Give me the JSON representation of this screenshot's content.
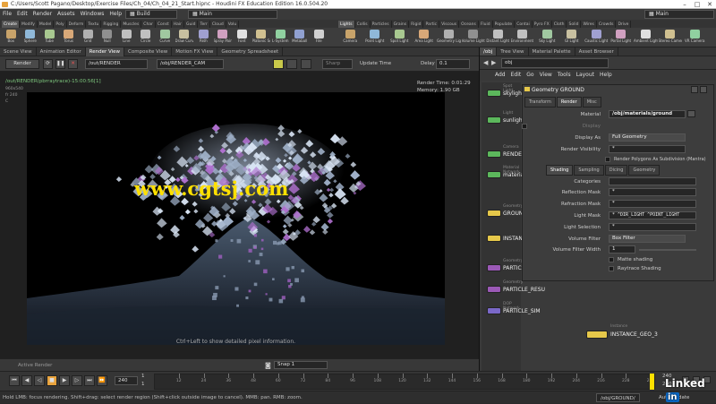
{
  "window": {
    "title": "C:/Users/Scott Pagano/Desktop/Exercise Files/Ch_04/Ch_04_21_Start.hipnc - Houdini FX Education Edition 16.0.504.20"
  },
  "menu": {
    "items": [
      "File",
      "Edit",
      "Render",
      "Assets",
      "Windows",
      "Help"
    ],
    "desktop_left": "Build",
    "desktop_center": "Main",
    "desktop_right": "Main"
  },
  "shelf": {
    "left_tabs": [
      "Create",
      "Modify",
      "Model",
      "Poly",
      "Deform",
      "Textu",
      "Rigging",
      "Muscles",
      "Char",
      "Const",
      "Hair",
      "Guid",
      "Terr",
      "Cloud",
      "Volu"
    ],
    "right_tabs": [
      "Lights",
      "Collis",
      "Particles",
      "Grains",
      "Rigid",
      "Partic",
      "Viscous",
      "Oceans",
      "Fluid",
      "Populate",
      "Contai",
      "Pyro FX",
      "Cloth",
      "Solid",
      "Wires",
      "Crowds",
      "Drive"
    ],
    "left_tools": [
      "Box",
      "Sphere",
      "Tube",
      "Torus",
      "Grid",
      "Null",
      "Line",
      "Circle",
      "Curve",
      "Draw Curve",
      "Path",
      "Spray Paint",
      "Font",
      "Platonic Solids",
      "L-System",
      "Metaball",
      "File"
    ],
    "right_tools": [
      "Camera",
      "Point Light",
      "Spot Light",
      "Area Light",
      "Geometry Light",
      "Volume Light",
      "Distant Light",
      "Environment Light",
      "Sky Light",
      "GI Light",
      "Caustic Light",
      "Portal Light",
      "Ambient Light",
      "Stereo Camera",
      "VR Camera"
    ]
  },
  "left_pane": {
    "tabs": [
      "Scene View",
      "Animation Editor",
      "Render View",
      "Composite View",
      "Motion FX View",
      "Geometry Spreadsheet"
    ],
    "toolbar": {
      "render_button": "Render",
      "out_path": "/out/RENDER",
      "cam_path": "/obj/RENDER_CAM",
      "sharp": "Sharp",
      "update_time": "Update Time",
      "delay_label": "Delay",
      "delay_value": "0.1"
    },
    "render_info": {
      "title": "/out/RENDER(pbrraytrace)-15:00:56[1]",
      "size": "960x540",
      "fr": "fr 240",
      "channel": "C",
      "render_time": "Render Time: 0:01:29",
      "memory": "Memory:      1.90 GB"
    },
    "watermark": "www.cgtsj.com",
    "hint": "Ctrl+Left to show detailed pixel information.",
    "bottom": {
      "active_render": "Active Render",
      "snap": "Snap 1"
    }
  },
  "right_pane": {
    "tabs": [
      "/obj",
      "Tree View",
      "Material Palette",
      "Asset Browser"
    ],
    "path": "obj",
    "menu": [
      "Add",
      "Edit",
      "Go",
      "View",
      "Tools",
      "Layout",
      "Help"
    ],
    "nodes": [
      {
        "type": "Spot Light",
        "name": "skylight1",
        "color": "#5cb85c"
      },
      {
        "type": "Light",
        "name": "sunlight1",
        "color": "#5cb85c"
      },
      {
        "type": "Camera",
        "name": "RENDER_CAM",
        "color": "#5cb85c"
      },
      {
        "type": "Material Network",
        "name": "materials",
        "color": "#5cb85c"
      },
      {
        "type": "Geometry",
        "name": "GROUND",
        "color": "#e6c84a"
      },
      {
        "type": "",
        "name": "INSTANCES",
        "color": "#e6c84a"
      },
      {
        "type": "Geometry",
        "name": "PARTICLE_SOU",
        "color": "#9b59b6"
      },
      {
        "type": "Geometry",
        "name": "PARTICLE_RESU",
        "color": "#9b59b6"
      },
      {
        "type": "DOP Network",
        "name": "PARTICLE_SIM",
        "color": "#7a68c8"
      }
    ],
    "instance_node": {
      "type": "Instance",
      "name": "INSTANCE_GEO_3"
    },
    "parms": {
      "header_type": "Geometry",
      "header_name": "GROUND",
      "tabs": [
        "Transform",
        "Render",
        "Misc"
      ],
      "material_label": "Material",
      "material_value": "/obj/materials/ground",
      "display_label": "Display",
      "display_as_label": "Display As",
      "display_as_value": "Full Geometry",
      "render_visibility_label": "Render Visibility",
      "render_visibility_value": "*",
      "subdiv_label": "Render Polygons As Subdivision (Mantra)",
      "subtabs": [
        "Shading",
        "Sampling",
        "Dicing",
        "Geometry"
      ],
      "categories_label": "Categories",
      "reflection_mask_label": "Reflection Mask",
      "reflection_mask_value": "*",
      "refraction_mask_label": "Refraction Mask",
      "refraction_mask_value": "*",
      "light_mask_label": "Light Mask",
      "light_mask_value": "* ^DIR_LIGHT ^POINT_LIGHT",
      "light_selection_label": "Light Selection",
      "light_selection_value": "*",
      "volume_filter_label": "Volume Filter",
      "volume_filter_value": "Box Filter",
      "volume_filter_width_label": "Volume Filter Width",
      "volume_filter_width_value": "1",
      "matte_label": "Matte shading",
      "raytrace_label": "Raytrace Shading"
    }
  },
  "timeline": {
    "current_frame": "240",
    "start": "1",
    "start2": "1",
    "ticks": [
      "12",
      "24",
      "36",
      "48",
      "60",
      "72",
      "84",
      "96",
      "108",
      "120",
      "132",
      "144",
      "156",
      "168",
      "180",
      "192",
      "204",
      "216",
      "228",
      "240"
    ],
    "end1": "240",
    "end2": "240"
  },
  "status": {
    "message": "Hold LMB: focus rendering. Shift+drag: select render region (Shift+click outside image to cancel). MMB: pan. RMB: zoom.",
    "path": "/obj/GROUND/",
    "auto_update": "Auto Update",
    "brand": "Linked"
  },
  "colors": {
    "accent": "#e8a33d",
    "node_green": "#5cb85c",
    "node_yellow": "#e6c84a",
    "node_purple": "#9b59b6",
    "watermark": "#ffe000"
  }
}
